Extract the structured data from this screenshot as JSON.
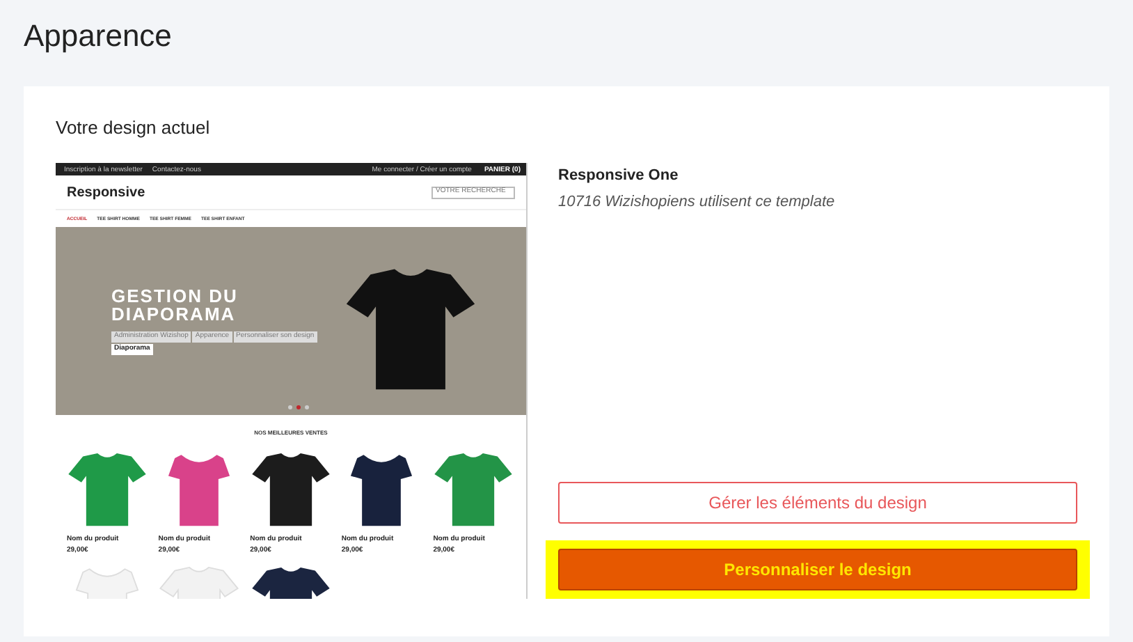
{
  "page_title": "Apparence",
  "card": {
    "heading": "Votre design actuel",
    "preview": {
      "top_bar_links": [
        "Inscription à la newsletter",
        "Contactez-nous"
      ],
      "account_link": "Me connecter / Créer un compte",
      "cart": "PANIER (0)",
      "logo": "Responsive",
      "search_placeholder": "VOTRE RECHERCHE",
      "nav": [
        {
          "label": "ACCUEIL",
          "selected": true
        },
        {
          "label": "TEE SHIRT HOMME",
          "selected": false
        },
        {
          "label": "TEE SHIRT FEMME",
          "selected": false
        },
        {
          "label": "TEE SHIRT ENFANT",
          "selected": false
        }
      ],
      "hero": {
        "title_lines": [
          "GESTION DU",
          "DIAPORAMA"
        ],
        "breadcrumb": [
          {
            "label": "Administration Wizishop",
            "selected": false
          },
          {
            "label": "Apparence",
            "selected": false
          },
          {
            "label": "Personnaliser son design",
            "selected": false
          },
          {
            "label": "Diaporama",
            "selected": true
          }
        ],
        "dots": [
          {
            "selected": false
          },
          {
            "selected": true
          },
          {
            "selected": false
          }
        ]
      },
      "section_title": "NOS MEILLEURES VENTES",
      "products": [
        {
          "kind": "tee",
          "color": "#1f9a48",
          "name": "Nom du produit",
          "price": "29,00€"
        },
        {
          "kind": "womens",
          "color": "#d9428a",
          "name": "Nom du produit",
          "price": "29,00€"
        },
        {
          "kind": "tee",
          "color": "#1c1c1c",
          "name": "Nom du produit",
          "price": "29,00€"
        },
        {
          "kind": "womens",
          "color": "#18223d",
          "name": "Nom du produit",
          "price": "29,00€"
        },
        {
          "kind": "tee",
          "color": "#239447",
          "name": "Nom du produit",
          "price": "29,00€"
        },
        {
          "kind": "womens",
          "color": "#f4f4f4"
        },
        {
          "kind": "tee",
          "color": "#f2f2f2"
        },
        {
          "kind": "tee",
          "color": "#1b2540"
        }
      ]
    },
    "template": {
      "name": "Responsive One",
      "usage": "10716 Wizishopiens utilisent ce template"
    },
    "buttons": [
      {
        "kind": "outline",
        "label": "Gérer les éléments du design",
        "highlighted": false
      },
      {
        "kind": "primary",
        "label": "Personnaliser le design",
        "highlighted": true
      }
    ]
  }
}
